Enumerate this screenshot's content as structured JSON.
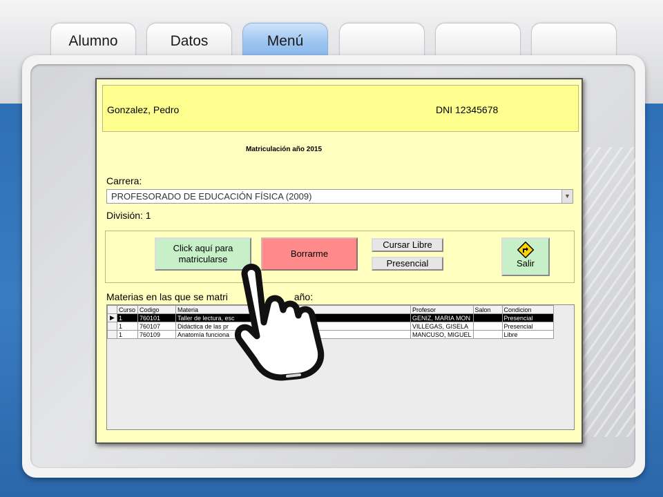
{
  "tabs": [
    {
      "label": "Alumno",
      "active": false
    },
    {
      "label": "Datos",
      "active": false
    },
    {
      "label": "Menú",
      "active": true
    },
    {
      "label": "",
      "active": false
    },
    {
      "label": "",
      "active": false
    },
    {
      "label": "",
      "active": false
    }
  ],
  "student": {
    "name": "Gonzalez, Pedro",
    "dni": "DNI  12345678"
  },
  "enrollment": {
    "title": "Matriculación año 2015",
    "carrera_label": "Carrera:",
    "carrera_value": "PROFESORADO DE EDUCACIÓN FÍSICA (2009)",
    "division_label": "División: 1"
  },
  "buttons": {
    "matricular": "Click aquí para matricularse",
    "borrar": "Borrarme",
    "cursar_libre": "Cursar Libre",
    "presencial": "Presencial",
    "salir": "Salir"
  },
  "materias": {
    "label": "Materias en las que se matri",
    "label_tail": "año:",
    "columns": [
      "Curso",
      "Codigo",
      "Materia",
      "Profesor",
      "Salon",
      "Condicion"
    ],
    "rows": [
      {
        "curso": "1",
        "codigo": "760101",
        "materia": "Taller de lectura, esc",
        "profesor": "GENIZ, MARIA MON",
        "salon": "",
        "condicion": "Presencial",
        "selected": true
      },
      {
        "curso": "1",
        "codigo": "760107",
        "materia": "Didáctica de las pr",
        "profesor": "VILLEGAS, GISELA",
        "salon": "",
        "condicion": "Presencial",
        "selected": false
      },
      {
        "curso": "1",
        "codigo": "760109",
        "materia": "Anatomía funciona",
        "profesor": "MANCUSO, MIGUEL",
        "salon": "",
        "condicion": "Libre",
        "selected": false
      }
    ]
  },
  "colors": {
    "form_bg": "#ffffc0",
    "header_bg": "#ffff90",
    "active_tab": "#9cc4f0",
    "matricular_btn": "#c8f0c8",
    "borrar_btn": "#ff8a8a",
    "blue_band": "#2e6fb5"
  },
  "icons": {
    "salir": "turn-right-road-sign-icon",
    "pointer": "pointing-hand-icon"
  }
}
